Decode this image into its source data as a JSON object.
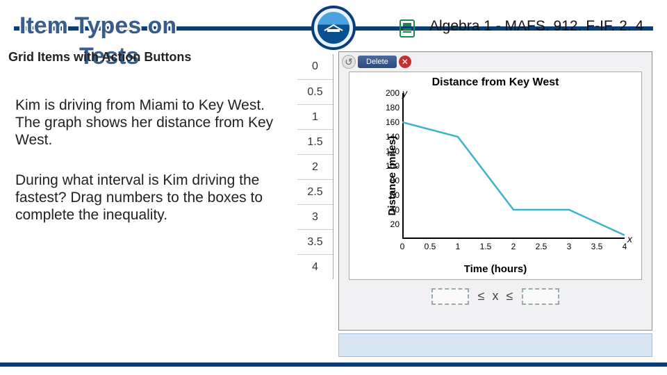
{
  "header": {
    "title_line": "Item Types on",
    "title_tests": "Tests",
    "subtitle": "Grid Items with Action Buttons",
    "standard": "Algebra 1 - MAFS. 912. F-IF. 2. 4"
  },
  "body": {
    "p1": "Kim is driving from Miami to Key West. The graph shows her distance from Key West.",
    "p2": "During what interval is Kim driving the fastest? Drag numbers to the boxes to complete the inequality."
  },
  "number_rail": [
    "0",
    "0.5",
    "1",
    "1.5",
    "2",
    "2.5",
    "3",
    "3.5",
    "4"
  ],
  "toolbar": {
    "delete_label": "Delete"
  },
  "answer": {
    "le1": "≤",
    "var": "x",
    "le2": "≤"
  },
  "chart_data": {
    "type": "line",
    "title": "Distance from Key West",
    "xlabel": "Time (hours)",
    "ylabel": "Distance (miles)",
    "x_var": "x",
    "y_var": "y",
    "xlim": [
      0,
      4
    ],
    "ylim": [
      0,
      200
    ],
    "x_ticks": [
      "0",
      "0.5",
      "1",
      "1.5",
      "2",
      "2.5",
      "3",
      "3.5",
      "4"
    ],
    "y_ticks": [
      "20",
      "40",
      "60",
      "80",
      "100",
      "120",
      "140",
      "160",
      "180",
      "200"
    ],
    "series": [
      {
        "name": "distance",
        "x": [
          0,
          0.5,
          1,
          2,
          2.5,
          3,
          4
        ],
        "y": [
          160,
          150,
          140,
          40,
          40,
          40,
          5
        ]
      }
    ]
  }
}
